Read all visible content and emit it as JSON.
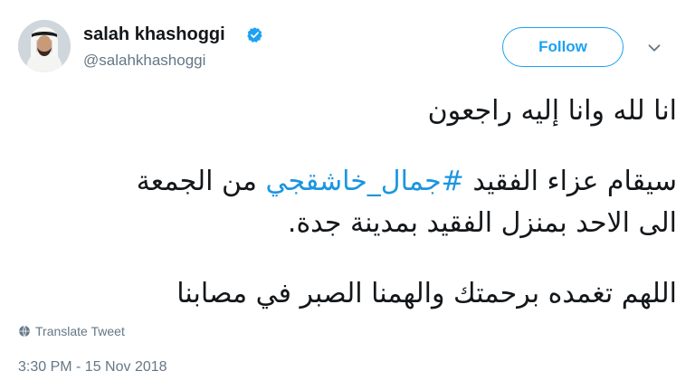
{
  "user": {
    "display_name": "salah khashoggi",
    "handle": "@salahkhashoggi",
    "verified_icon": "verified-badge-icon",
    "avatar_icon": "avatar-photo"
  },
  "header": {
    "follow_label": "Follow",
    "menu_icon": "chevron-down-icon"
  },
  "tweet": {
    "line1": "انا لله وانا إليه راجعون",
    "line2_before": "سيقام عزاء الفقيد ",
    "hashtag": "#جمال_خاشقجي",
    "line2_after": " من الجمعة",
    "line3": "الى الاحد بمنزل الفقيد بمدينة جدة.",
    "line4": "اللهم تغمده برحمتك والهمنا الصبر في مصابنا"
  },
  "translate": {
    "label": "Translate Tweet",
    "icon": "globe-icon"
  },
  "timestamp": "3:30 PM - 15 Nov 2018",
  "colors": {
    "accent": "#1da1f2",
    "hashtag": "#1b95e0",
    "muted": "#657786",
    "text": "#14171a"
  }
}
